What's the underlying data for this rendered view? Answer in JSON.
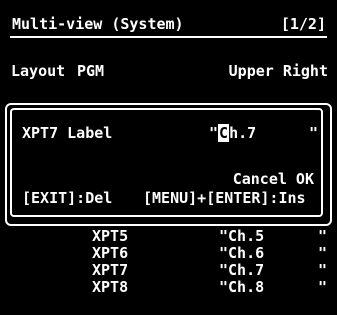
{
  "header": {
    "title": "Multi-view (System)",
    "page": "[1/2]"
  },
  "subheader": {
    "layout_label": "Layout",
    "layout_value": "PGM",
    "position": "Upper Right"
  },
  "dialog": {
    "label": "XPT7 Label",
    "value_open_quote": "\"",
    "value_cursor_char": "C",
    "value_rest": "h.7",
    "value_close_quote": "\"",
    "actions": "Cancel OK",
    "hint_delete": "[EXIT]:Del",
    "hint_insert": "[MENU]+[ENTER]:Ins"
  },
  "rows": [
    {
      "label": "XPT5",
      "value": "\"Ch.5",
      "close": "\""
    },
    {
      "label": "XPT6",
      "value": "\"Ch.6",
      "close": "\""
    },
    {
      "label": "XPT7",
      "value": "\"Ch.7",
      "close": "\""
    },
    {
      "label": "XPT8",
      "value": "\"Ch.8",
      "close": "\""
    }
  ]
}
